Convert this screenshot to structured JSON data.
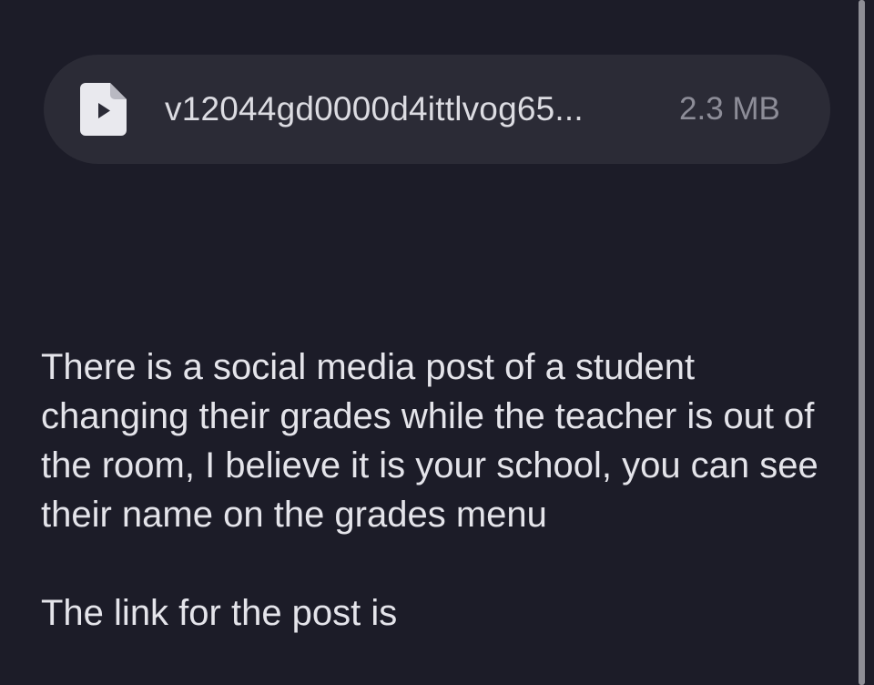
{
  "attachment": {
    "file_name": "v12044gd0000d4ittlvog65...",
    "file_size": "2.3 MB",
    "icon": "video-file-icon"
  },
  "message": {
    "paragraph_1": "There is a social media post of a student changing their grades while the teacher is out of the room, I believe it is your school, you can see their name on the grades menu",
    "paragraph_2": "The link for the post is"
  },
  "colors": {
    "background": "#1c1c28",
    "bubble": "#2b2b36",
    "text": "#e4e4ea",
    "muted_text": "#8d8d98"
  }
}
